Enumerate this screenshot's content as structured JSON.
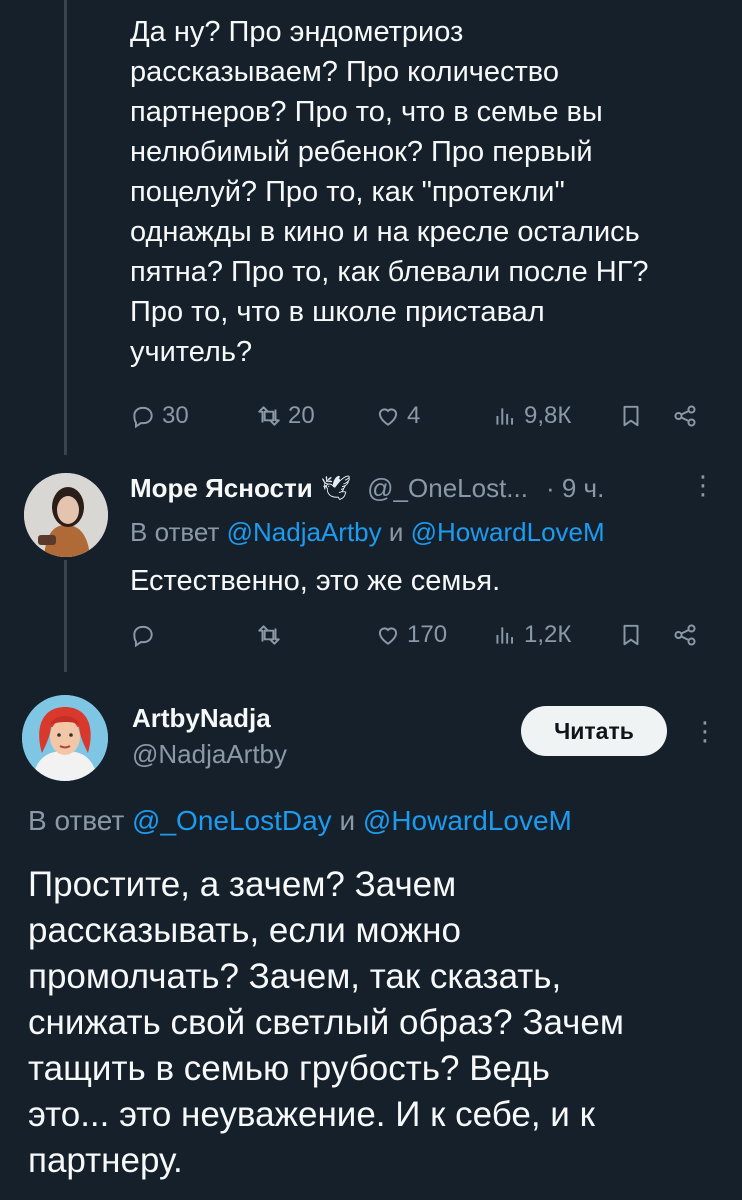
{
  "prev_tweet": {
    "text": "Да ну? Про эндометриоз\nрассказываем? Про количество\nпартнеров? Про то, что в семье вы\nнелюбимый ребенок? Про первый\nпоцелуй? Про то, как \"протекли\"\nоднажды в кино и на кресле остались\nпятна? Про то, как блевали после НГ?\nПро то, что в школе приставал\nучитель?",
    "stats": {
      "replies": "30",
      "retweets": "20",
      "likes": "4",
      "views": "9,8К"
    }
  },
  "reply_tweet": {
    "name": "Море Ясности",
    "name_emoji": "🕊",
    "handle": "@_OneLost...",
    "time": "· 9 ч.",
    "reply_prefix": "В ответ",
    "reply_user1": "@NadjaArtby",
    "reply_and": "и",
    "reply_user2": "@HowardLoveM",
    "text": "Естественно, это же семья.",
    "stats": {
      "likes": "170",
      "views": "1,2К"
    }
  },
  "main_tweet": {
    "name": "ArtbyNadja",
    "handle": "@NadjaArtby",
    "follow_label": "Читать",
    "reply_prefix": "В ответ",
    "reply_user1": "@_OneLostDay",
    "reply_and": "и",
    "reply_user2": "@HowardLoveM",
    "text": "Простите, а зачем? Зачем\nрассказывать, если можно\nпромолчать? Зачем, так сказать,\nснижать свой светлый образ? Зачем\nтащить в семью грубость? Ведь\nэто...  это неуважение. И к себе, и к\nпартнеру."
  },
  "colors": {
    "background": "#15202b",
    "text": "#f7f9f9",
    "muted": "#8b98a5",
    "link": "#1d9bf0",
    "button": "#eff3f4"
  }
}
